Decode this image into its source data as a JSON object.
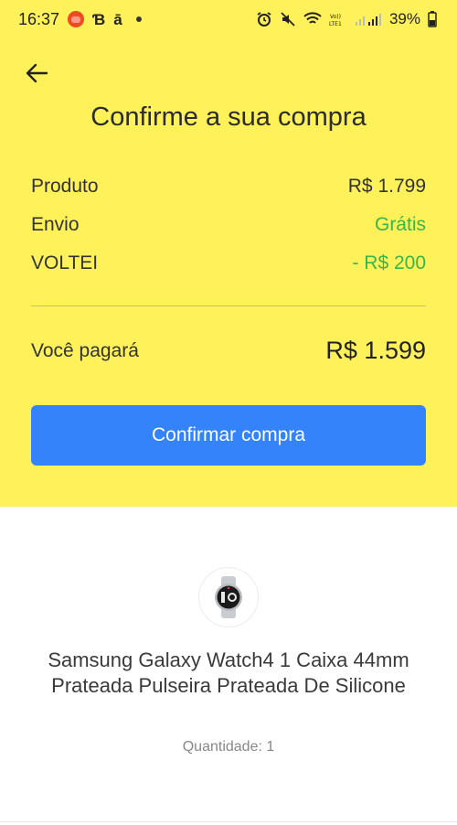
{
  "status_bar": {
    "time": "16:37",
    "app_glyph_1": "Ɓ",
    "app_glyph_2": "ā",
    "battery": "39%",
    "icons": [
      "alarm-icon",
      "mute-icon",
      "wifi-icon",
      "volte-icon",
      "signal-icon",
      "battery-icon"
    ]
  },
  "header": {
    "title": "Confirme a sua compra"
  },
  "summary": {
    "rows": [
      {
        "label": "Produto",
        "value": "R$ 1.799"
      },
      {
        "label": "Envio",
        "value": "Grátis"
      },
      {
        "label": "VOLTEI",
        "value": "- R$ 200"
      }
    ],
    "total_label": "Você pagará",
    "total_value": "R$ 1.599"
  },
  "actions": {
    "confirm_label": "Confirmar compra"
  },
  "product": {
    "name": "Samsung Galaxy Watch4 1  Caixa 44mm  Prateada Pulseira  Prateada De Silicone",
    "quantity": "Quantidade: 1"
  },
  "colors": {
    "panel_bg": "#fff159",
    "button_bg": "#3483fa",
    "positive": "#39b54a"
  }
}
